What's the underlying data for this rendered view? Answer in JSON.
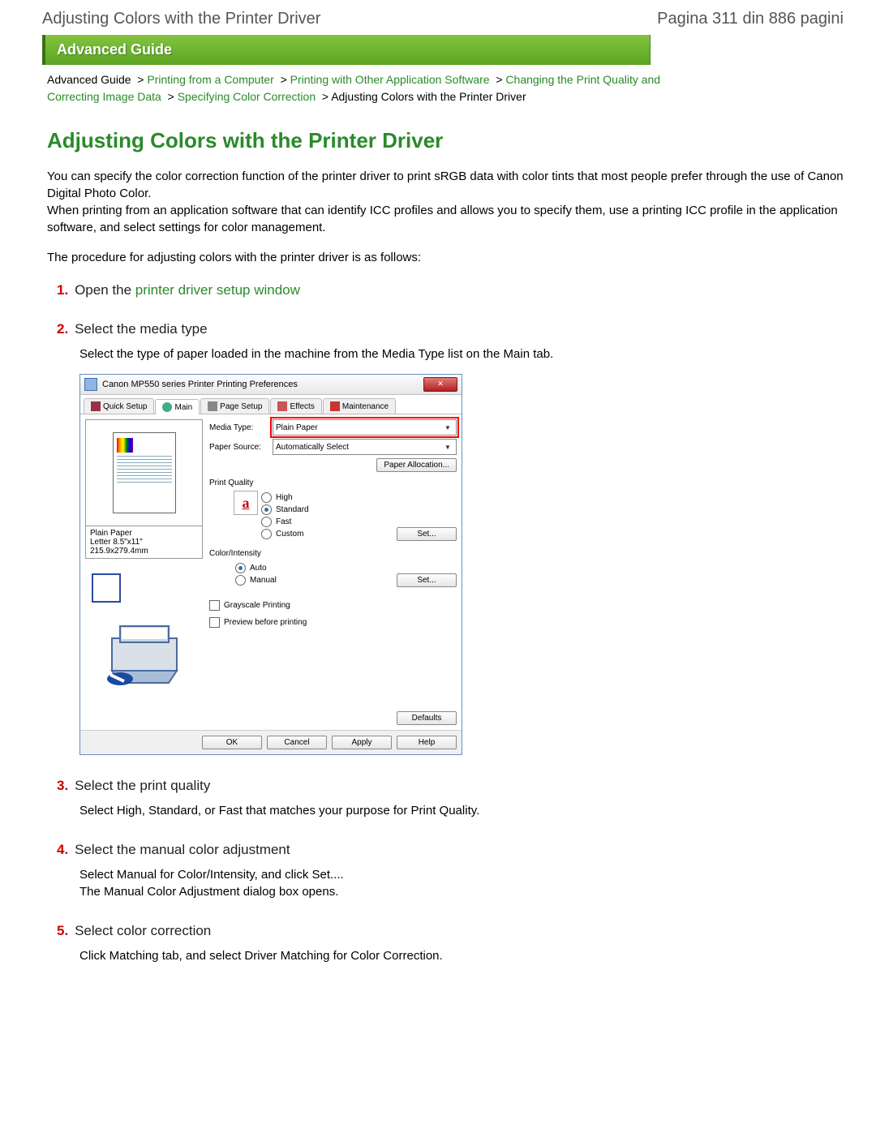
{
  "header": {
    "left": "Adjusting Colors with the Printer Driver",
    "right": "Pagina 311 din 886 pagini"
  },
  "banner": "Advanced Guide",
  "breadcrumb": {
    "items": [
      {
        "label": "Advanced Guide",
        "plain": true
      },
      {
        "label": "Printing from a Computer"
      },
      {
        "label": "Printing with Other Application Software"
      },
      {
        "label": "Changing the Print Quality and Correcting Image Data"
      },
      {
        "label": "Specifying Color Correction"
      }
    ],
    "current": "Adjusting Colors with the Printer Driver"
  },
  "title": "Adjusting Colors with the Printer Driver",
  "intro1": "You can specify the color correction function of the printer driver to print sRGB data with color tints that most people prefer through the use of Canon Digital Photo Color.",
  "intro2": "When printing from an application software that can identify ICC profiles and allows you to specify them, use a printing ICC profile in the application software, and select settings for color management.",
  "procedure_intro": "The procedure for adjusting colors with the printer driver is as follows:",
  "steps": [
    {
      "num": "1.",
      "title_before": "Open the ",
      "title_link": "printer driver setup window",
      "body": ""
    },
    {
      "num": "2.",
      "title_before": "Select the media type",
      "body": "Select the type of paper loaded in the machine from the Media Type list on the Main tab."
    },
    {
      "num": "3.",
      "title_before": "Select the print quality",
      "body": "Select High, Standard, or Fast that matches your purpose for Print Quality."
    },
    {
      "num": "4.",
      "title_before": "Select the manual color adjustment",
      "body": "Select Manual for Color/Intensity, and click Set....\nThe Manual Color Adjustment dialog box opens."
    },
    {
      "num": "5.",
      "title_before": "Select color correction",
      "body": "Click Matching tab, and select Driver Matching for Color Correction."
    }
  ],
  "dialog": {
    "title": "Canon MP550 series Printer Printing Preferences",
    "close": "✕",
    "tabs": [
      "Quick Setup",
      "Main",
      "Page Setup",
      "Effects",
      "Maintenance"
    ],
    "media_type_label": "Media Type:",
    "media_type_value": "Plain Paper",
    "paper_source_label": "Paper Source:",
    "paper_source_value": "Automatically Select",
    "paper_allocation": "Paper Allocation...",
    "print_quality_label": "Print Quality",
    "quality_options": [
      "High",
      "Standard",
      "Fast",
      "Custom"
    ],
    "quality_selected": 1,
    "set_btn": "Set...",
    "color_intensity_label": "Color/Intensity",
    "color_options": [
      "Auto",
      "Manual"
    ],
    "color_selected": 0,
    "grayscale": "Grayscale Printing",
    "preview_before": "Preview before printing",
    "defaults": "Defaults",
    "ok": "OK",
    "cancel": "Cancel",
    "apply": "Apply",
    "help": "Help",
    "preview_caption1": "Plain Paper",
    "preview_caption2": "Letter 8.5\"x11\" 215.9x279.4mm",
    "icon_letter": "a"
  }
}
